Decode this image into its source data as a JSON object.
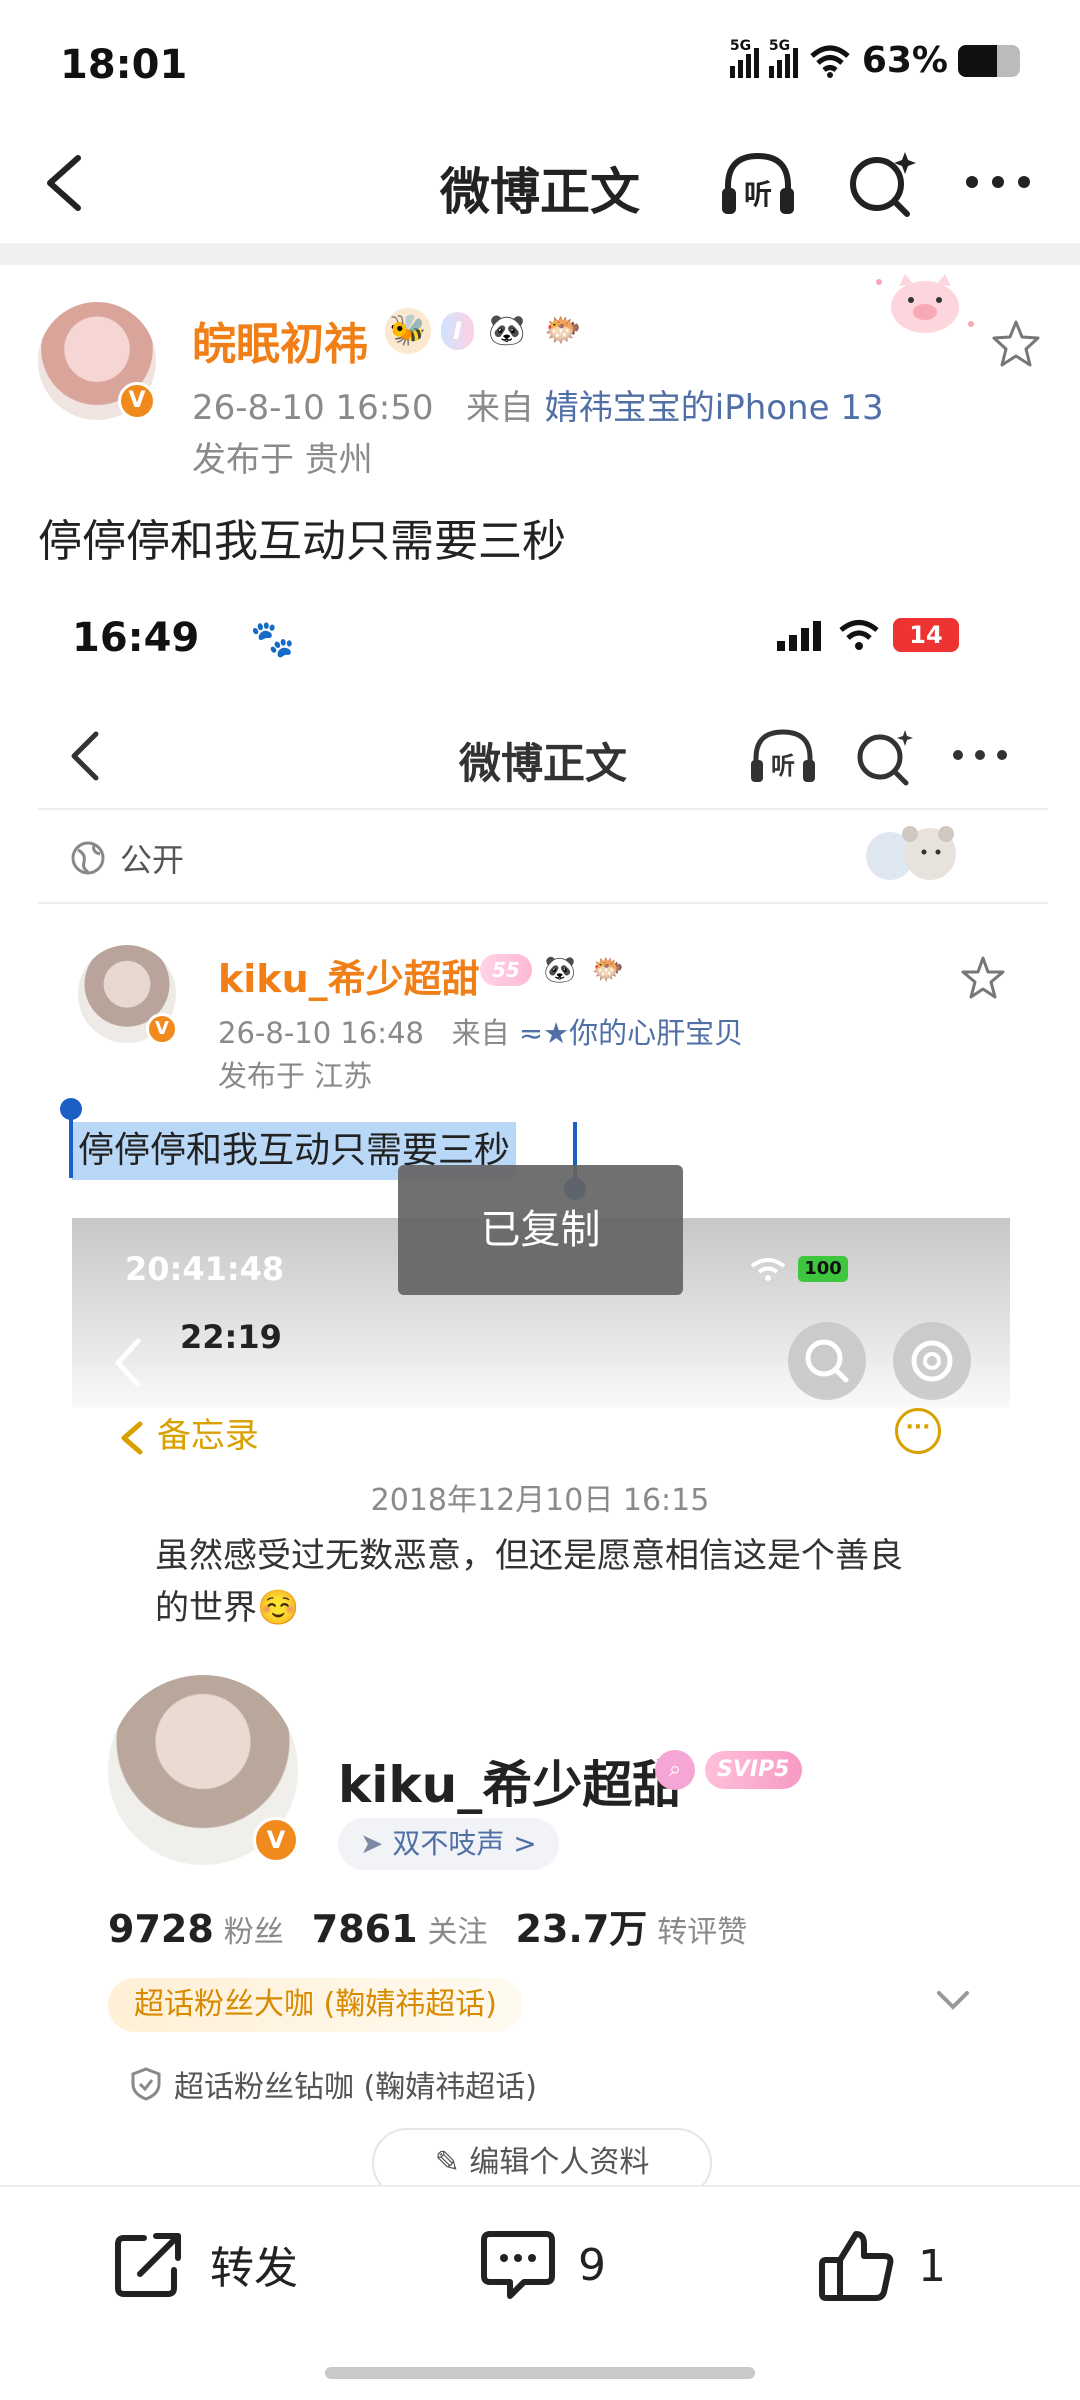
{
  "status_bar": {
    "time": "18:01",
    "network1": "5G",
    "network2": "5G",
    "battery_text": "63%",
    "battery_level": 0.63
  },
  "header": {
    "title": "微博正文",
    "listen_label": "听"
  },
  "post": {
    "username": "皖眠初祎",
    "badge_text": "I",
    "timestamp": "26-8-10 16:50",
    "from_label": "来自",
    "source": "婧祎宝宝的iPhone 13",
    "location": "发布于 贵州",
    "text": "停停停和我互动只需要三秒"
  },
  "embedded": {
    "status_time": "16:49",
    "battery": "14",
    "title": "微博正文",
    "listen_label": "听",
    "visibility": "公开",
    "username": "kiku_希少超甜",
    "badge_level": "55",
    "timestamp": "26-8-10 16:48",
    "from_label": "来自",
    "source": "≂★你的心肝宝贝",
    "location": "发布于 江苏",
    "selected_text": "停停停和我互动只需要三秒",
    "toast": "已复制"
  },
  "nested": {
    "status_time": "20:41:48",
    "battery": "100",
    "inner_time": "22:19",
    "memo_back": "备忘录",
    "memo_date": "2018年12月10日 16:15",
    "memo_text": "虽然感受过无数恶意，但还是愿意相信这是个善良的世界☺️",
    "profile_name": "kiku_希少超甜",
    "svip": "SVIP5",
    "tag": "双不吱声 >",
    "stats": [
      {
        "num": "9728",
        "label": "粉丝"
      },
      {
        "num": "7861",
        "label": "关注"
      },
      {
        "num": "23.7万",
        "label": "转评赞"
      }
    ],
    "fan_badge": "超话粉丝大咖 (鞠婧祎超话)",
    "fan_badge2": "超话粉丝钻咖 (鞠婧祎超话)",
    "edit_profile": "编辑个人资料"
  },
  "bottom_bar": {
    "repost": "转发",
    "comment_count": "9",
    "like_count": "1"
  }
}
